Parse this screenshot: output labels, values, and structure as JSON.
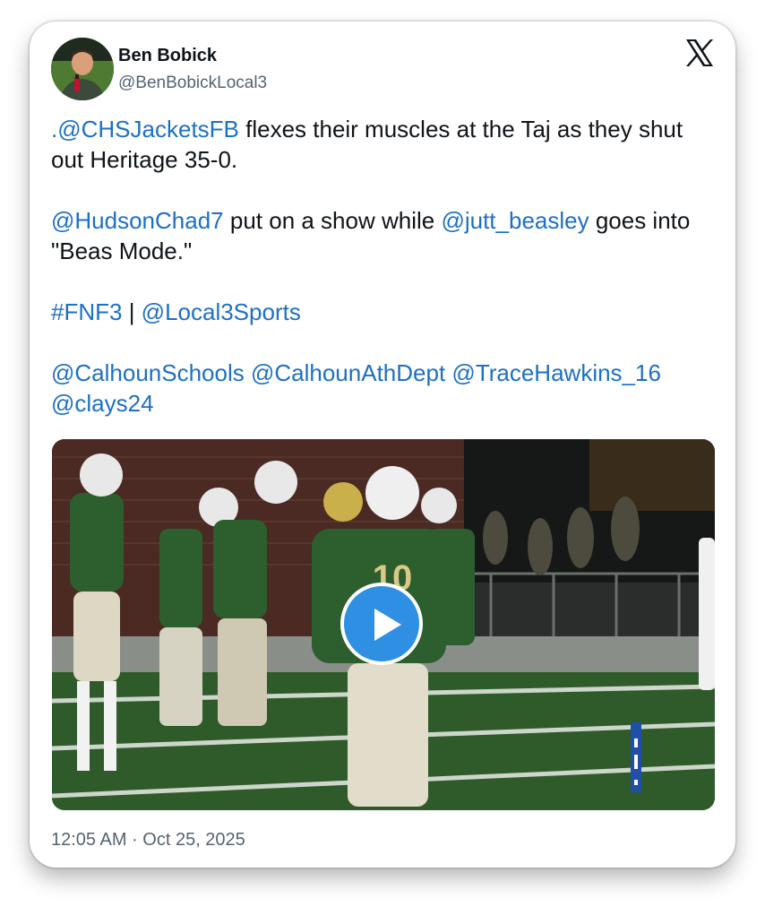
{
  "author": {
    "name": "Ben Bobick",
    "handle": "@BenBobickLocal3"
  },
  "tweet": {
    "mention_1": "@CHSJacketsFB",
    "lead_dot": ".",
    "text_1": " flexes their muscles at the Taj as they shut out Heritage 35-0.",
    "mention_2": "@HudsonChad7",
    "text_2": " put on a show while ",
    "mention_3": "@jutt_beasley",
    "text_3": " goes into \"Beas Mode.\"",
    "hashtag": "#FNF3",
    "separator": " | ",
    "mention_4": "@Local3Sports",
    "tags": [
      "@CalhounSchools",
      "@CalhounAthDept",
      "@TraceHawkins_16",
      "@clays24"
    ]
  },
  "media": {
    "type": "video",
    "jersey_number": "10"
  },
  "timestamp": "12:05 AM · Oct 25, 2025",
  "icons": {
    "platform": "x-logo-icon",
    "play": "play-icon"
  },
  "colors": {
    "link": "#1d70c4",
    "text": "#0f1419",
    "muted": "#536471",
    "play_button": "#2f8fe2",
    "jersey": "#2c5e2e"
  }
}
